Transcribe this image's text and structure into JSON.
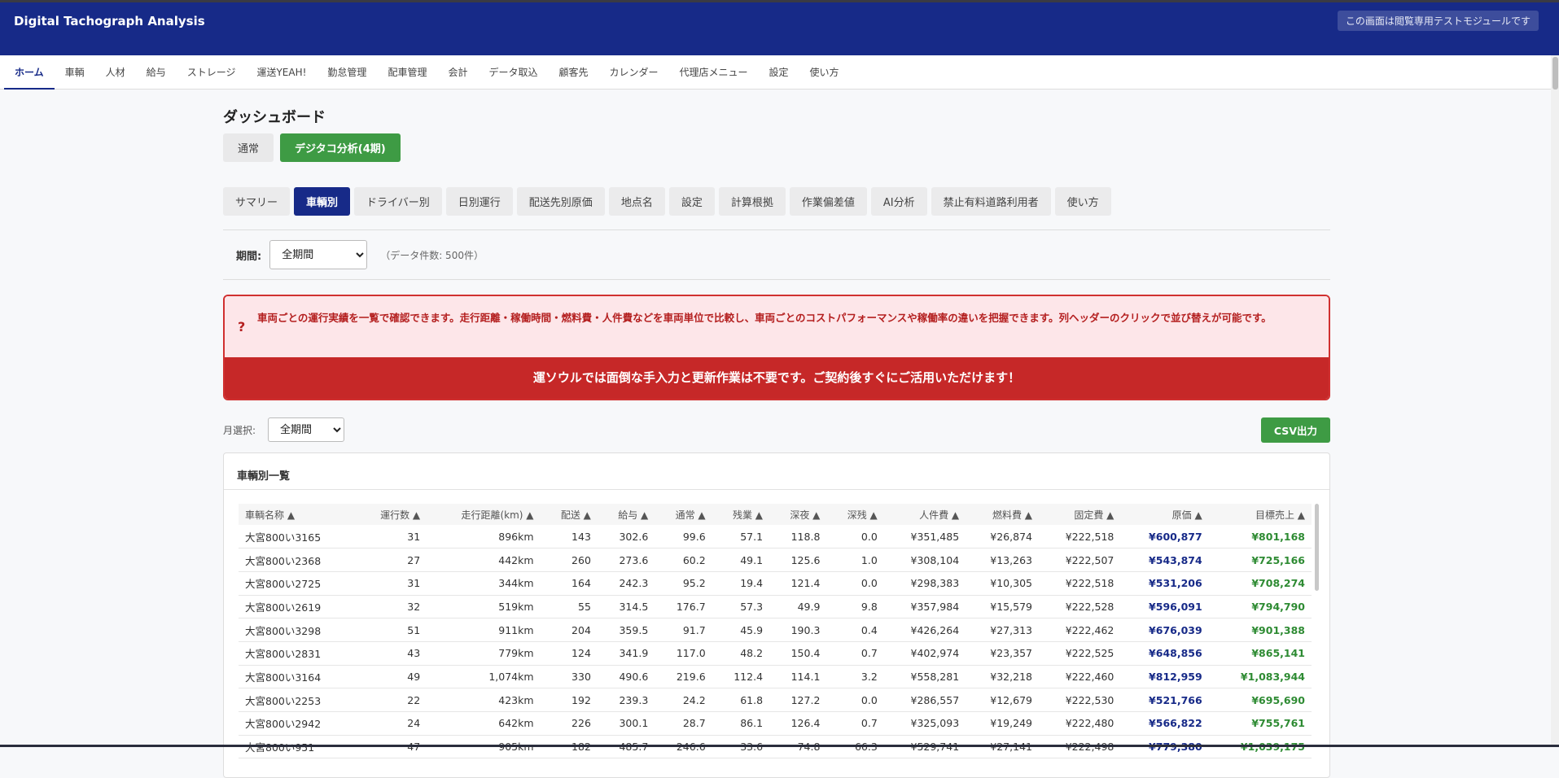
{
  "header": {
    "title": "Digital Tachograph Analysis",
    "badge": "この画面は閲覧専用テストモジュールです"
  },
  "nav": [
    "ホーム",
    "車輌",
    "人材",
    "給与",
    "ストレージ",
    "運送YEAH!",
    "勤怠管理",
    "配車管理",
    "会計",
    "データ取込",
    "顧客先",
    "カレンダー",
    "代理店メニュー",
    "設定",
    "使い方"
  ],
  "page_title": "ダッシュボード",
  "modes": [
    "通常",
    "デジタコ分析(4期)"
  ],
  "tabs": [
    "サマリー",
    "車輌別",
    "ドライバー別",
    "日別運行",
    "配送先別原価",
    "地点名",
    "設定",
    "計算根拠",
    "作業偏差値",
    "AI分析",
    "禁止有料道路利用者",
    "使い方"
  ],
  "period": {
    "label": "期間:",
    "value": "全期間",
    "count": "（データ件数: 500件）"
  },
  "alert": {
    "icon": "?",
    "text": "車両ごとの運行実績を一覧で確認できます。走行距離・稼働時間・燃料費・人件費などを車両単位で比較し、車両ごとのコストパフォーマンスや稼働率の違いを把握できます。列ヘッダーのクリックで並び替えが可能です。",
    "banner": "運ソウルでは面倒な手入力と更新作業は不要です。ご契約後すぐにご活用いただけます！"
  },
  "month": {
    "label": "月選択:",
    "value": "全期間",
    "csv": "CSV出力"
  },
  "card_title": "車輌別一覧",
  "columns": [
    "車輌名称 ▲",
    "運行数 ▲",
    "走行距離(km) ▲",
    "配送 ▲",
    "給与 ▲",
    "通常 ▲",
    "残業 ▲",
    "深夜 ▲",
    "深残 ▲",
    "人件費 ▲",
    "燃料費 ▲",
    "固定費 ▲",
    "原価 ▲",
    "目標売上 ▲"
  ],
  "rows": [
    [
      "大宮800い3165",
      "31",
      "896km",
      "143",
      "302.6",
      "99.6",
      "57.1",
      "118.8",
      "0.0",
      "¥351,485",
      "¥26,874",
      "¥222,518",
      "¥600,877",
      "¥801,168"
    ],
    [
      "大宮800い2368",
      "27",
      "442km",
      "260",
      "273.6",
      "60.2",
      "49.1",
      "125.6",
      "1.0",
      "¥308,104",
      "¥13,263",
      "¥222,507",
      "¥543,874",
      "¥725,166"
    ],
    [
      "大宮800い2725",
      "31",
      "344km",
      "164",
      "242.3",
      "95.2",
      "19.4",
      "121.4",
      "0.0",
      "¥298,383",
      "¥10,305",
      "¥222,518",
      "¥531,206",
      "¥708,274"
    ],
    [
      "大宮800い2619",
      "32",
      "519km",
      "55",
      "314.5",
      "176.7",
      "57.3",
      "49.9",
      "9.8",
      "¥357,984",
      "¥15,579",
      "¥222,528",
      "¥596,091",
      "¥794,790"
    ],
    [
      "大宮800い3298",
      "51",
      "911km",
      "204",
      "359.5",
      "91.7",
      "45.9",
      "190.3",
      "0.4",
      "¥426,264",
      "¥27,313",
      "¥222,462",
      "¥676,039",
      "¥901,388"
    ],
    [
      "大宮800い2831",
      "43",
      "779km",
      "124",
      "341.9",
      "117.0",
      "48.2",
      "150.4",
      "0.7",
      "¥402,974",
      "¥23,357",
      "¥222,525",
      "¥648,856",
      "¥865,141"
    ],
    [
      "大宮800い3164",
      "49",
      "1,074km",
      "330",
      "490.6",
      "219.6",
      "112.4",
      "114.1",
      "3.2",
      "¥558,281",
      "¥32,218",
      "¥222,460",
      "¥812,959",
      "¥1,083,944"
    ],
    [
      "大宮800い2253",
      "22",
      "423km",
      "192",
      "239.3",
      "24.2",
      "61.8",
      "127.2",
      "0.0",
      "¥286,557",
      "¥12,679",
      "¥222,530",
      "¥521,766",
      "¥695,690"
    ],
    [
      "大宮800い2942",
      "24",
      "642km",
      "226",
      "300.1",
      "28.7",
      "86.1",
      "126.4",
      "0.7",
      "¥325,093",
      "¥19,249",
      "¥222,480",
      "¥566,822",
      "¥755,761"
    ],
    [
      "大宮800い951",
      "47",
      "905km",
      "182",
      "485.7",
      "246.6",
      "33.6",
      "74.8",
      "66.3",
      "¥529,741",
      "¥27,141",
      "¥222,498",
      "¥779,380",
      "¥1,039,175"
    ]
  ]
}
